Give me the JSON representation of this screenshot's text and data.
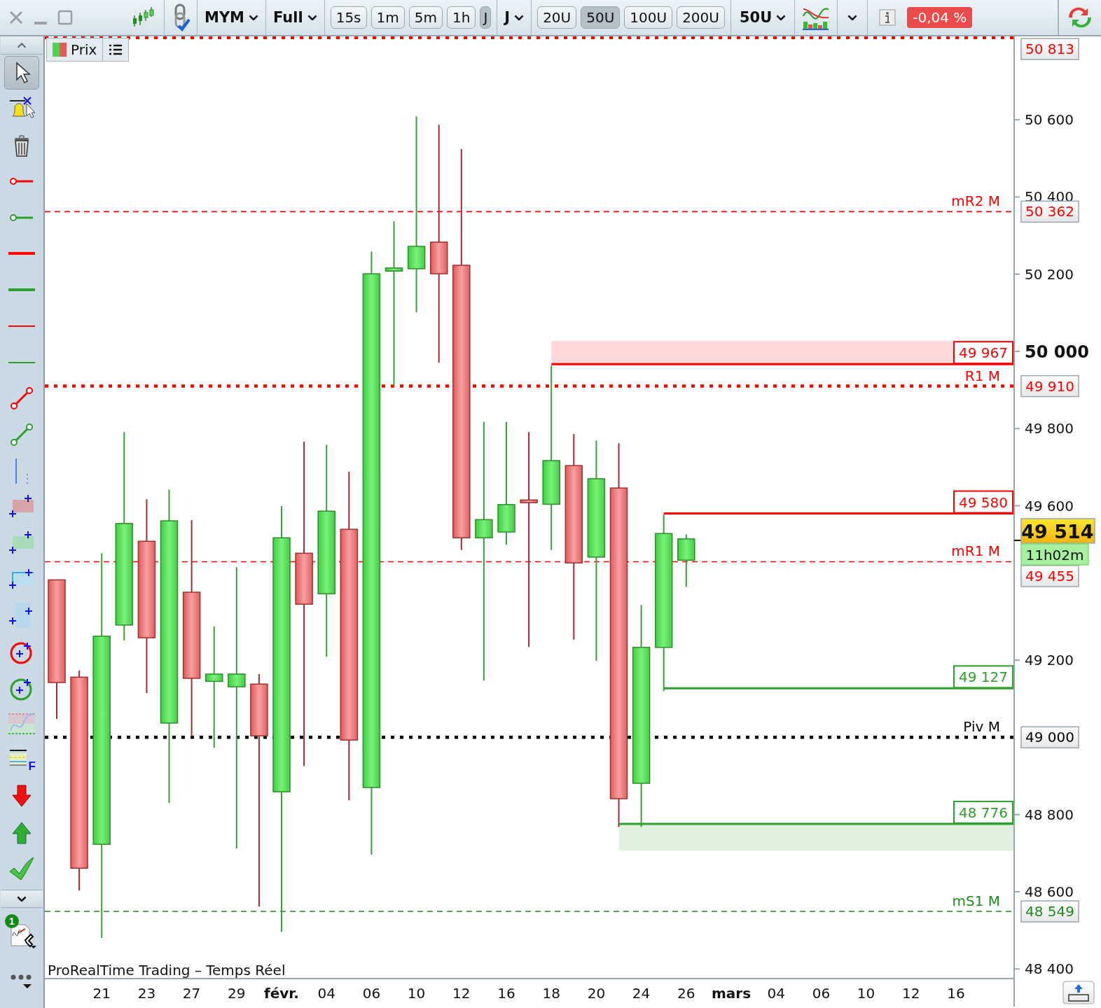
{
  "window_controls": [
    {
      "kind": "close"
    },
    {
      "kind": "minimize"
    },
    {
      "kind": "maximize"
    }
  ],
  "toolbar": {
    "symbol": "MYM",
    "range": "Full",
    "periods": [
      {
        "label": "15s",
        "selected": false
      },
      {
        "label": "1m",
        "selected": false
      },
      {
        "label": "5m",
        "selected": false
      },
      {
        "label": "1h",
        "selected": false
      },
      {
        "label": "J",
        "selected": true
      }
    ],
    "period_menu": "J",
    "units": [
      {
        "label": "20U",
        "selected": false
      },
      {
        "label": "50U",
        "selected": true
      },
      {
        "label": "100U",
        "selected": false
      },
      {
        "label": "200U",
        "selected": false
      }
    ],
    "unit_menu": "50U",
    "change": "-0,04 %"
  },
  "legend": {
    "label": "Prix"
  },
  "tools": [
    {
      "kind": "pointer",
      "selected": true
    },
    {
      "kind": "alert",
      "selected": false
    },
    {
      "kind": "trash",
      "selected": false
    },
    {
      "kind": "ray",
      "color": "#ff0000",
      "selected": false
    },
    {
      "kind": "ray",
      "color": "#2ca02c",
      "selected": false
    },
    {
      "kind": "hline-thick",
      "color": "#ff0000",
      "selected": false
    },
    {
      "kind": "hline-thick",
      "color": "#2ca02c",
      "selected": false
    },
    {
      "kind": "hline-thin",
      "color": "#ff0000",
      "selected": false
    },
    {
      "kind": "hline-thin",
      "color": "#2ca02c",
      "selected": false
    },
    {
      "kind": "segment",
      "color": "#ff0000",
      "selected": false
    },
    {
      "kind": "segment",
      "color": "#2ca02c",
      "selected": false
    },
    {
      "kind": "vline",
      "selected": false
    },
    {
      "kind": "rect",
      "color": "#d9a3aa",
      "selected": false
    },
    {
      "kind": "rect",
      "color": "#a8dcb8",
      "selected": false
    },
    {
      "kind": "channel",
      "selected": false
    },
    {
      "kind": "band",
      "selected": false
    },
    {
      "kind": "circle",
      "color": "#ff0000",
      "selected": false
    },
    {
      "kind": "circle",
      "color": "#2ca02c",
      "selected": false
    },
    {
      "kind": "zone",
      "selected": false
    },
    {
      "kind": "fib",
      "label": "F",
      "selected": false
    },
    {
      "kind": "arrow-down",
      "selected": false
    },
    {
      "kind": "arrow-up",
      "selected": false
    },
    {
      "kind": "check",
      "selected": false
    }
  ],
  "tools_badge": "1",
  "chart": {
    "source": "ProRealTime Trading – Temps Réel",
    "price_axis": [
      {
        "label": "50 600",
        "major": false
      },
      {
        "label": "50 400",
        "major": false
      },
      {
        "label": "50 200",
        "major": false
      },
      {
        "label": "50 000",
        "major": true
      },
      {
        "label": "49 800",
        "major": false
      },
      {
        "label": "49 600",
        "major": false
      },
      {
        "label": "49 200",
        "major": false
      },
      {
        "label": "48 800",
        "major": false
      },
      {
        "label": "48 600",
        "major": false
      },
      {
        "label": "48 400",
        "major": false
      }
    ],
    "date_axis": [
      {
        "label": "21",
        "major": false
      },
      {
        "label": "23",
        "major": false
      },
      {
        "label": "27",
        "major": false
      },
      {
        "label": "29",
        "major": false
      },
      {
        "label": "févr.",
        "major": true
      },
      {
        "label": "04",
        "major": false
      },
      {
        "label": "06",
        "major": false
      },
      {
        "label": "10",
        "major": false
      },
      {
        "label": "12",
        "major": false
      },
      {
        "label": "16",
        "major": false
      },
      {
        "label": "18",
        "major": false
      },
      {
        "label": "20",
        "major": false
      },
      {
        "label": "24",
        "major": false
      },
      {
        "label": "26",
        "major": false
      },
      {
        "label": "mars",
        "major": true
      },
      {
        "label": "04",
        "major": false
      },
      {
        "label": "06",
        "major": false
      },
      {
        "label": "10",
        "major": false
      },
      {
        "label": "12",
        "major": false
      },
      {
        "label": "16",
        "major": false
      }
    ],
    "levels": [
      {
        "kind": "dotted",
        "color": "#ff0000",
        "tag": "50 813"
      },
      {
        "kind": "dashed",
        "color": "#ff0000",
        "label": "mR2 M",
        "tag": "50 362"
      },
      {
        "kind": "zone",
        "color": "#ff0000",
        "tag": "49 967"
      },
      {
        "kind": "dotted",
        "color": "#ff0000",
        "label": "R1 M",
        "tag": "49 910"
      },
      {
        "kind": "level",
        "color": "#ff0000",
        "tag": "49 580"
      },
      {
        "kind": "dashed",
        "color": "#ff0000",
        "label": "mR1 M",
        "tag": "49 455"
      },
      {
        "kind": "level",
        "color": "#2ca02c",
        "tag": "49 127"
      },
      {
        "kind": "dotted",
        "color": "#000000",
        "label": "Piv M",
        "tag": "49 000"
      },
      {
        "kind": "zone",
        "color": "#2ca02c",
        "tag": "48 776"
      },
      {
        "kind": "dashed",
        "color": "#1e8c1e",
        "label": "mS1 M",
        "tag": "48 549"
      }
    ],
    "last_price": "49 514",
    "countdown": "11h02m"
  }
}
